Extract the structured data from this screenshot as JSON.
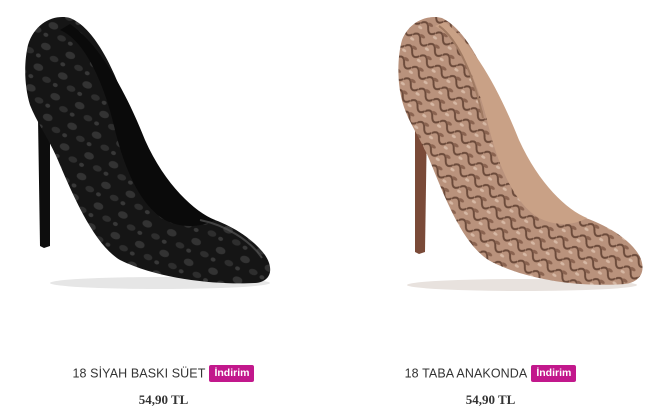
{
  "products": [
    {
      "name": "18 SİYAH BASKI SÜET",
      "badge": "İndirim",
      "price": "54,90 TL",
      "image_icon": "black-leopard-suede-pump",
      "colors": {
        "base": "#141414",
        "pattern": "#3a3a3a"
      }
    },
    {
      "name": "18 TABA ANAKONDA",
      "badge": "İndirim",
      "price": "54,90 TL",
      "image_icon": "brown-snakeskin-pump",
      "colors": {
        "base": "#b08670",
        "pattern": "#5a3a2c"
      }
    }
  ],
  "badge_color": "#c2188c"
}
